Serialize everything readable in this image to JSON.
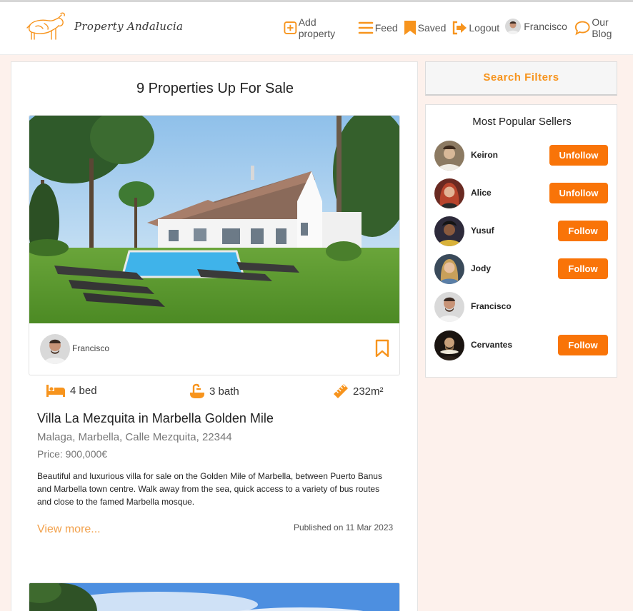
{
  "brand": {
    "name": "Property Andalucia",
    "accent": "#f7941d",
    "button_color": "#f97408"
  },
  "nav": {
    "add_property": "Add property",
    "feed": "Feed",
    "saved": "Saved",
    "logout": "Logout",
    "user": "Francisco",
    "blog": "Our Blog"
  },
  "main": {
    "title": "9 Properties Up For Sale",
    "listing": {
      "seller": "Francisco",
      "beds": "4 bed",
      "baths": "3 bath",
      "area": "232m²",
      "title": "Villa La Mezquita in Marbella Golden Mile",
      "address": "Malaga, Marbella, Calle Mezquita, 22344",
      "price": "Price: 900,000€",
      "description": "Beautiful and luxurious villa for sale on the Golden Mile of Marbella, between Puerto Banus and Marbella town centre. Walk away from the sea, quick access to a variety of bus routes and close to the famed Marbella mosque.",
      "view_more": "View more...",
      "published": "Published on 11 Mar 2023"
    }
  },
  "sidebar": {
    "search_filters": "Search Filters",
    "popular_title": "Most Popular Sellers",
    "sellers": [
      {
        "name": "Keiron",
        "action": "Unfollow"
      },
      {
        "name": "Alice",
        "action": "Unfollow"
      },
      {
        "name": "Yusuf",
        "action": "Follow"
      },
      {
        "name": "Jody",
        "action": "Follow"
      },
      {
        "name": "Francisco",
        "action": ""
      },
      {
        "name": "Cervantes",
        "action": "Follow"
      }
    ]
  }
}
